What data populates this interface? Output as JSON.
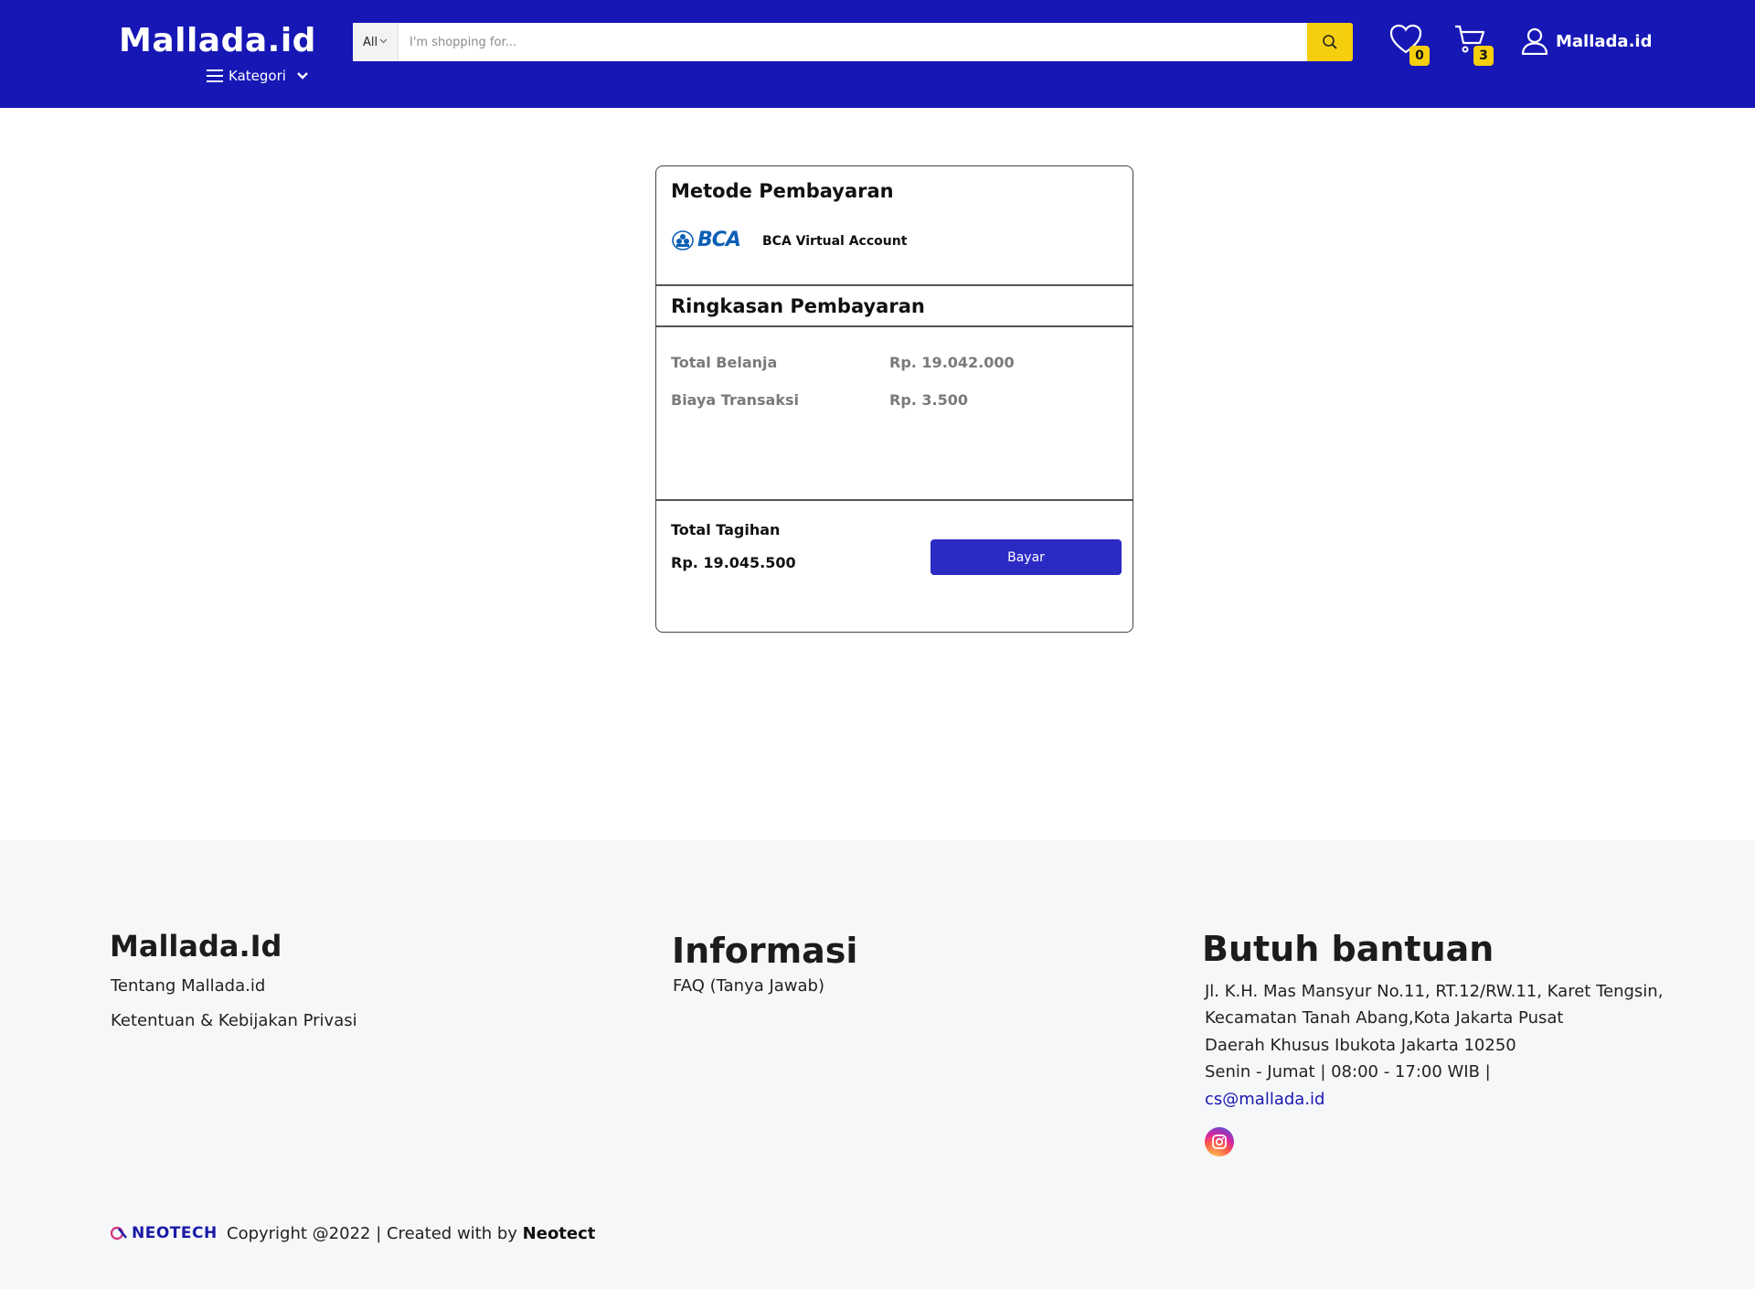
{
  "header": {
    "logo": "Mallada.id",
    "kategori_label": "Kategori",
    "search": {
      "category": "All",
      "placeholder": "I'm shopping for..."
    },
    "wishlist_count": "0",
    "cart_count": "3",
    "account_label": "Mallada.id"
  },
  "payment": {
    "method_title": "Metode Pembayaran",
    "method_logo_text": "BCA",
    "method_name": "BCA Virtual Account",
    "summary_title": "Ringkasan Pembayaran",
    "rows": [
      {
        "label": "Total Belanja",
        "value": "Rp. 19.042.000"
      },
      {
        "label": "Biaya Transaksi",
        "value": "Rp. 3.500"
      }
    ],
    "total_label": "Total Tagihan",
    "total_value": "Rp. 19.045.500",
    "pay_button": "Bayar"
  },
  "footer": {
    "col1": {
      "title": "Mallada.Id",
      "links": [
        "Tentang Mallada.id",
        "Ketentuan & Kebijakan Privasi"
      ]
    },
    "col2": {
      "title": "Informasi",
      "links": [
        "FAQ (Tanya Jawab)"
      ]
    },
    "col3": {
      "title": "Butuh bantuan",
      "lines": [
        "Jl. K.H. Mas Mansyur No.11, RT.12/RW.11, Karet Tengsin,",
        "Kecamatan Tanah Abang,Kota Jakarta Pusat",
        "Daerah Khusus Ibukota Jakarta 10250",
        "Senin - Jumat | 08:00 - 17:00 WIB |"
      ],
      "email": "cs@mallada.id"
    },
    "brand_logo_text": "NEOTECH",
    "copyright": "Copyright @2022 | Created with by",
    "creator": "Neotect"
  }
}
